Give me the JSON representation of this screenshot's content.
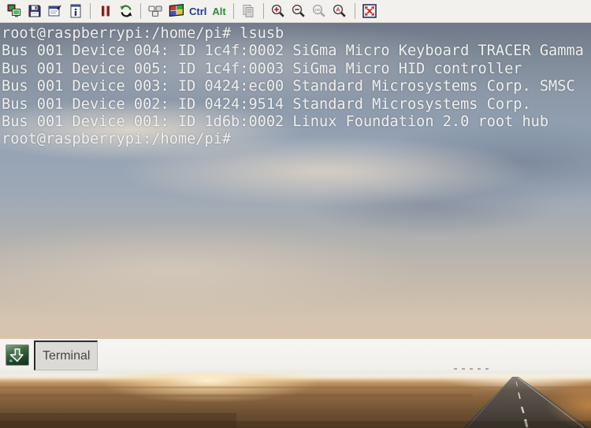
{
  "toolbar": {
    "ctrl_label": "Ctrl",
    "alt_label": "Alt",
    "buttons": [
      {
        "name": "new-connection",
        "icon": "monitors-icon",
        "enabled": true
      },
      {
        "name": "save-session",
        "icon": "floppy-disk-icon",
        "enabled": true
      },
      {
        "name": "connection-options",
        "icon": "window-options-icon",
        "enabled": true
      },
      {
        "name": "connection-info",
        "icon": "info-document-icon",
        "enabled": true
      },
      {
        "name": "pause",
        "icon": "pause-bars-icon",
        "enabled": true
      },
      {
        "name": "refresh",
        "icon": "refresh-arrows-icon",
        "enabled": true
      },
      {
        "name": "send-ctrl-alt-del",
        "icon": "keyboard-keys-icon",
        "enabled": true
      },
      {
        "name": "send-ctrl-esc",
        "icon": "windows-flag-icon",
        "enabled": true
      },
      {
        "name": "ctrl-toggle",
        "icon": "none",
        "enabled": true
      },
      {
        "name": "alt-toggle",
        "icon": "none",
        "enabled": true
      },
      {
        "name": "file-transfer",
        "icon": "copy-documents-icon",
        "enabled": false
      },
      {
        "name": "zoom-in",
        "icon": "magnifier-plus-icon",
        "enabled": true
      },
      {
        "name": "zoom-out",
        "icon": "magnifier-minus-icon",
        "enabled": true
      },
      {
        "name": "zoom-100",
        "icon": "magnifier-100-icon",
        "enabled": false
      },
      {
        "name": "zoom-auto",
        "icon": "magnifier-a-icon",
        "enabled": true
      },
      {
        "name": "fullscreen",
        "icon": "fullscreen-arrows-icon",
        "enabled": true
      }
    ]
  },
  "terminal": {
    "lines": [
      "root@raspberrypi:/home/pi# lsusb",
      "Bus 001 Device 004: ID 1c4f:0002 SiGma Micro Keyboard TRACER Gamma",
      "Bus 001 Device 005: ID 1c4f:0003 SiGma Micro HID controller",
      "Bus 001 Device 003: ID 0424:ec00 Standard Microsystems Corp. SMSC",
      "Bus 001 Device 002: ID 0424:9514 Standard Microsystems Corp.",
      "Bus 001 Device 001: ID 1d6b:0002 Linux Foundation 2.0 root hub",
      "root@raspberrypi:/home/pi#"
    ],
    "text_color": "#f0efed"
  },
  "taskbar": {
    "terminal_button_label": "Terminal",
    "launcher_icon": "green-down-arrow-icon"
  },
  "colors": {
    "toolbar_bg": "#f2f1ee",
    "ctrl_text": "#1f3a8c",
    "alt_text": "#2e8b2e",
    "pause_red": "#8c1d1d",
    "magnifier_symbol_red": "#c22222",
    "launcher_green": "#2c5233",
    "taskbar_bg": "#f3f1ee",
    "task_button_bg": "#dcdad6"
  }
}
